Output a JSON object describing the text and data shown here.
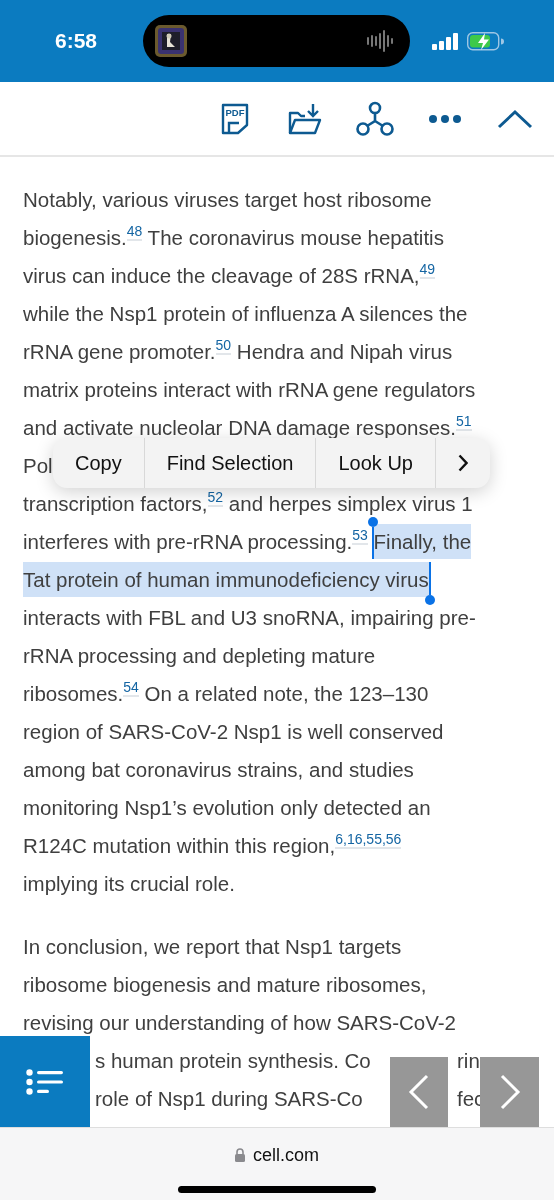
{
  "status_bar": {
    "time": "6:58"
  },
  "toolbar": {
    "buttons": [
      {
        "kind": "pdf",
        "label": "PDF"
      },
      {
        "kind": "download"
      },
      {
        "kind": "share"
      },
      {
        "kind": "more"
      },
      {
        "kind": "collapse"
      }
    ]
  },
  "article": {
    "paragraphs": [
      {
        "lines": [
          {
            "kind": "text",
            "segments": [
              {
                "kind": "text",
                "text": "Notably, various viruses target host ribosome",
                "selected": false
              }
            ]
          },
          {
            "kind": "text",
            "segments": [
              {
                "kind": "text",
                "text": "biogenesis.",
                "selected": false
              },
              {
                "kind": "ref",
                "text": "48",
                "selected": false
              },
              {
                "kind": "text",
                "text": " The coronavirus mouse hepatitis",
                "selected": false
              }
            ]
          },
          {
            "kind": "text",
            "segments": [
              {
                "kind": "text",
                "text": "virus can induce the cleavage of 28S rRNA,",
                "selected": false
              },
              {
                "kind": "ref",
                "text": "49",
                "selected": false
              }
            ]
          },
          {
            "kind": "text",
            "segments": [
              {
                "kind": "text",
                "text": "while the Nsp1 protein of influenza A silences the",
                "selected": false
              }
            ]
          },
          {
            "kind": "text",
            "segments": [
              {
                "kind": "text",
                "text": "rRNA gene promoter.",
                "selected": false
              },
              {
                "kind": "ref",
                "text": "50",
                "selected": false
              },
              {
                "kind": "text",
                "text": " Hendra and Nipah virus",
                "selected": false
              }
            ]
          },
          {
            "kind": "text",
            "segments": [
              {
                "kind": "text",
                "text": "matrix proteins interact with rRNA gene regulators",
                "selected": false
              }
            ]
          },
          {
            "kind": "text",
            "segments": [
              {
                "kind": "text",
                "text": "and activate nucleolar DNA damage responses.",
                "selected": false
              },
              {
                "kind": "ref",
                "text": "51",
                "selected": false
              }
            ]
          },
          {
            "kind": "menu",
            "segments": [
              {
                "kind": "text",
                "text": "Pol",
                "selected": false
              }
            ]
          },
          {
            "kind": "text",
            "segments": [
              {
                "kind": "text",
                "text": "transcription factors,",
                "selected": false
              },
              {
                "kind": "ref",
                "text": "52",
                "selected": false
              },
              {
                "kind": "text",
                "text": " and herpes simplex virus 1",
                "selected": false
              }
            ]
          },
          {
            "kind": "text",
            "segments": [
              {
                "kind": "text",
                "text": "interferes with pre-rRNA processing.",
                "selected": false
              },
              {
                "kind": "ref",
                "text": "53",
                "selected": false
              },
              {
                "kind": "text",
                "text": "Finally, the",
                "selected": true
              }
            ]
          },
          {
            "kind": "text",
            "segments": [
              {
                "kind": "text",
                "text": "Tat protein of human immunodeficiency virus",
                "selected": true
              }
            ]
          },
          {
            "kind": "text",
            "segments": [
              {
                "kind": "text",
                "text": "interacts with FBL and U3 snoRNA, impairing pre-",
                "selected": false
              }
            ]
          },
          {
            "kind": "text",
            "segments": [
              {
                "kind": "text",
                "text": "rRNA processing and depleting mature",
                "selected": false
              }
            ]
          },
          {
            "kind": "text",
            "segments": [
              {
                "kind": "text",
                "text": "ribosomes.",
                "selected": false
              },
              {
                "kind": "ref",
                "text": "54",
                "selected": false
              },
              {
                "kind": "text",
                "text": " On a related note, the 123–130",
                "selected": false
              }
            ]
          },
          {
            "kind": "text",
            "segments": [
              {
                "kind": "text",
                "text": "region of SARS-CoV-2 Nsp1 is well conserved",
                "selected": false
              }
            ]
          },
          {
            "kind": "text",
            "segments": [
              {
                "kind": "text",
                "text": "among bat coronavirus strains, and studies",
                "selected": false
              }
            ]
          },
          {
            "kind": "text",
            "segments": [
              {
                "kind": "text",
                "text": "monitoring Nsp1’s evolution only detected an",
                "selected": false
              }
            ]
          },
          {
            "kind": "text",
            "segments": [
              {
                "kind": "text",
                "text": "R124C mutation within this region,",
                "selected": false
              },
              {
                "kind": "ref",
                "text": "6,16,55,56",
                "selected": false
              }
            ]
          },
          {
            "kind": "text",
            "segments": [
              {
                "kind": "text",
                "text": "implying its crucial role.",
                "selected": false
              }
            ]
          }
        ]
      },
      {
        "lines": [
          {
            "kind": "text",
            "segments": [
              {
                "kind": "text",
                "text": "In conclusion, we report that Nsp1 targets",
                "selected": false
              }
            ]
          },
          {
            "kind": "text",
            "segments": [
              {
                "kind": "text",
                "text": "ribosome biogenesis and mature ribosomes,",
                "selected": false
              }
            ]
          },
          {
            "kind": "text",
            "segments": [
              {
                "kind": "text",
                "text": "revising our understanding of how SARS-CoV-2",
                "selected": false
              }
            ]
          },
          {
            "kind": "covered",
            "segments": [
              {
                "kind": "text",
                "text": "s human protein synthesis. Co",
                "selected": false
              }
            ],
            "fragment": "rin"
          },
          {
            "kind": "covered",
            "segments": [
              {
                "kind": "text",
                "text": "role of Nsp1 during SARS-Co",
                "selected": false
              }
            ],
            "fragment": "fec"
          }
        ]
      }
    ]
  },
  "context_menu": {
    "items": [
      {
        "kind": "text",
        "label": "Copy"
      },
      {
        "kind": "text",
        "label": "Find Selection"
      },
      {
        "kind": "text",
        "label": "Look Up"
      },
      {
        "kind": "more"
      }
    ]
  },
  "floating_buttons": [
    {
      "kind": "contents"
    },
    {
      "kind": "previous"
    },
    {
      "kind": "next"
    }
  ],
  "browser_bar": {
    "url": "cell.com",
    "secure": true
  }
}
